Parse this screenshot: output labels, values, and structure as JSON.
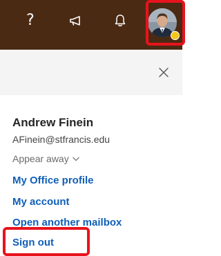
{
  "topbar": {
    "help_label": "?",
    "help_icon": "help-icon",
    "announcement_icon": "megaphone-icon",
    "notification_icon": "bell-icon",
    "avatar_icon": "user-avatar",
    "presence_color": "#f5c518",
    "background_color": "#4a2a13"
  },
  "panel": {
    "close_icon": "close-icon",
    "header_background": "#f4f4f4"
  },
  "user": {
    "name": "Andrew Finein",
    "email": "AFinein@stfrancis.edu",
    "status": "Appear away"
  },
  "menu": {
    "profile": "My Office profile",
    "account": "My account",
    "mailbox": "Open another mailbox",
    "signout": "Sign out",
    "link_color": "#0f5fb8"
  },
  "highlight": {
    "color": "#e8131d"
  }
}
